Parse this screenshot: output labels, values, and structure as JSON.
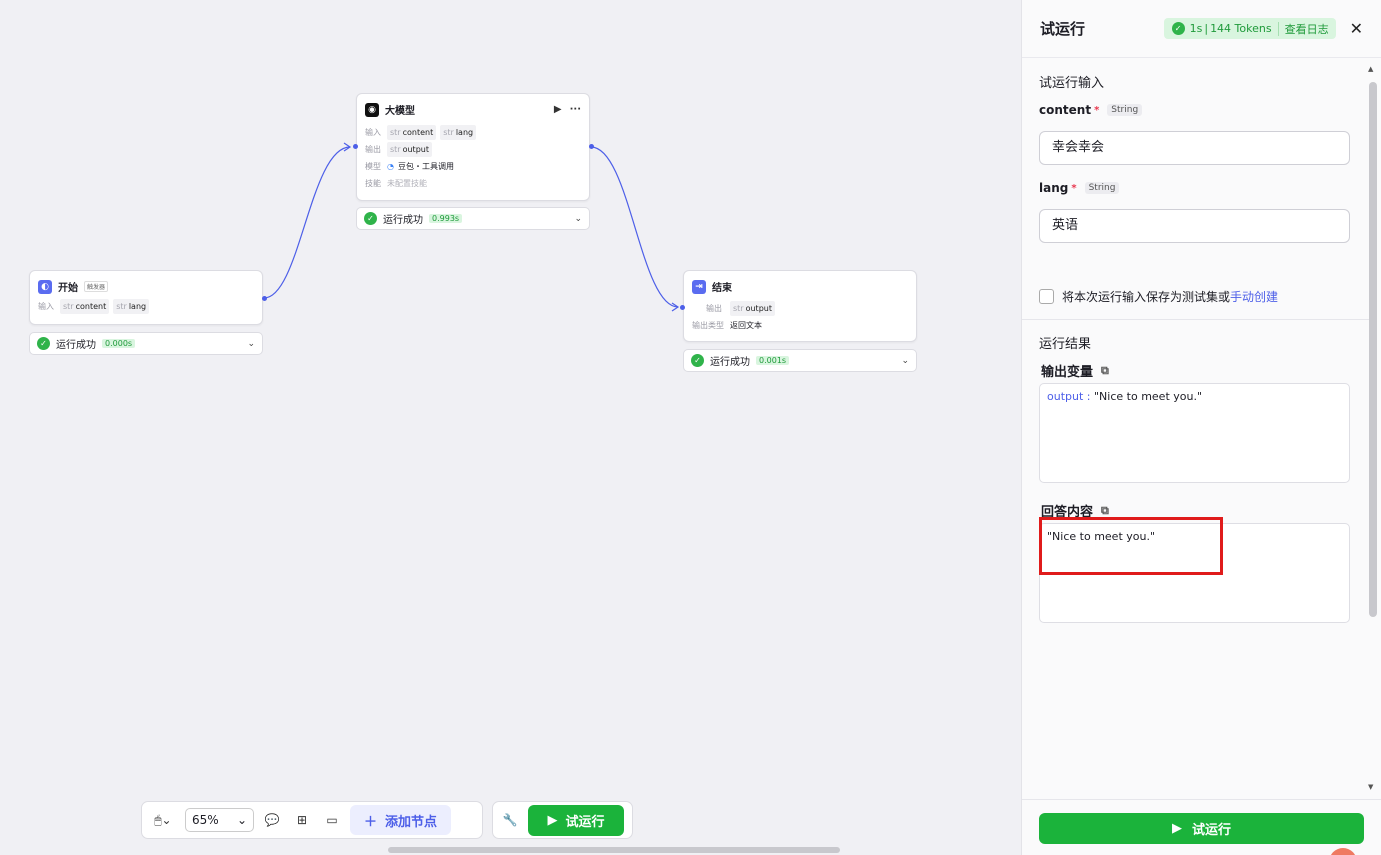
{
  "canvas": {
    "start_node": {
      "title": "开始",
      "tag": "触发器",
      "input_label": "输入",
      "vars": [
        {
          "type": "str",
          "name": "content"
        },
        {
          "type": "str",
          "name": "lang"
        }
      ],
      "status": "运行成功",
      "time": "0.000s"
    },
    "llm_node": {
      "title": "大模型",
      "run_icon": "▶",
      "more_icon": "···",
      "input_label": "输入",
      "input_vars": [
        {
          "type": "str",
          "name": "content"
        },
        {
          "type": "str",
          "name": "lang"
        }
      ],
      "output_label": "输出",
      "output_vars": [
        {
          "type": "str",
          "name": "output"
        }
      ],
      "model_label": "模型",
      "model_value": "豆包・工具调用",
      "skill_label": "技能",
      "skill_value": "未配置技能",
      "status": "运行成功",
      "time": "0.993s"
    },
    "end_node": {
      "title": "结束",
      "output_label": "输出",
      "output_vars": [
        {
          "type": "str",
          "name": "output"
        }
      ],
      "output_type_label": "输出类型",
      "output_type_value": "返回文本",
      "status": "运行成功",
      "time": "0.001s"
    }
  },
  "toolbar": {
    "zoom": "65%",
    "add_node": "添加节点",
    "run": "试运行"
  },
  "panel": {
    "title": "试运行",
    "stats": {
      "duration": "1s",
      "separator": "|",
      "tokens": "144 Tokens",
      "log_link": "查看日志"
    },
    "input_section": "试运行输入",
    "fields": [
      {
        "name": "content",
        "type": "String",
        "value": "幸会幸会"
      },
      {
        "name": "lang",
        "type": "String",
        "value": "英语"
      }
    ],
    "save_text": "将本次运行输入保存为测试集或",
    "save_link": "手动创建",
    "result_section": "运行结果",
    "output_vars_title": "输出变量",
    "output_key": "output",
    "output_sep": " : ",
    "output_value": "\"Nice to meet you.\"",
    "answer_title": "回答内容",
    "answer_value": "\"Nice to meet you.\"",
    "run_button": "试运行"
  },
  "colors": {
    "accent": "#4d5fe8",
    "success": "#1bb33b",
    "highlight": "#e01b1b"
  }
}
